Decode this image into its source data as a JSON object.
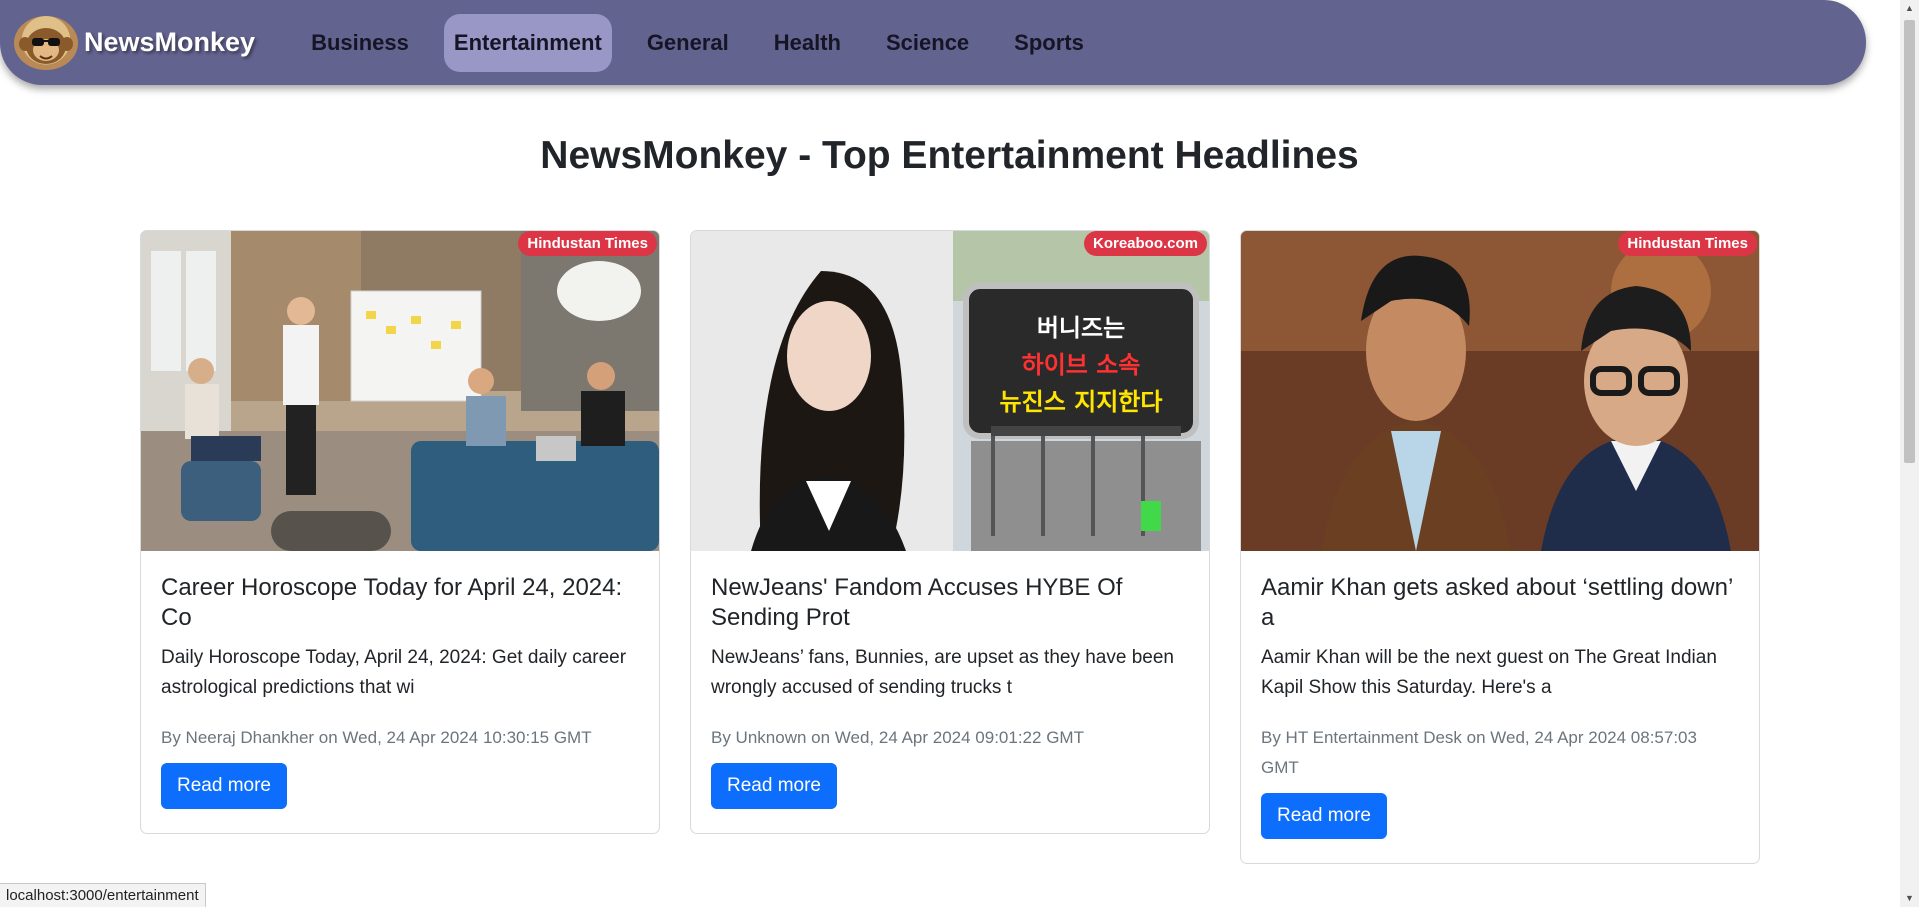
{
  "navbar": {
    "brand": "NewsMonkey",
    "links": [
      {
        "label": "Business",
        "active": false
      },
      {
        "label": "Entertainment",
        "active": true
      },
      {
        "label": "General",
        "active": false
      },
      {
        "label": "Health",
        "active": false
      },
      {
        "label": "Science",
        "active": false
      },
      {
        "label": "Sports",
        "active": false
      }
    ]
  },
  "page": {
    "heading": "NewsMonkey - Top Entertainment Headlines"
  },
  "articles": [
    {
      "source": "Hindustan Times",
      "title": "Career Horoscope Today for April 24, 2024: Co",
      "description": "Daily Horoscope Today, April 24, 2024: Get daily career astrological predictions that wi",
      "meta": "By Neeraj Dhankher on Wed, 24 Apr 2024 10:30:15 GMT",
      "button": "Read more"
    },
    {
      "source": "Koreaboo.com",
      "title": "NewJeans' Fandom Accuses HYBE Of Sending Prot",
      "description": "NewJeans’ fans, Bunnies, are upset as they have been wrongly accused of sending trucks t",
      "meta": "By Unknown on Wed, 24 Apr 2024 09:01:22 GMT",
      "button": "Read more",
      "image_sign_lines": [
        "버니즈는",
        "하이브 소속",
        "뉴진스 지지한다"
      ]
    },
    {
      "source": "Hindustan Times",
      "title": "Aamir Khan gets asked about ‘settling down’ a",
      "description": "Aamir Khan will be the next guest on The Great Indian Kapil Show this Saturday. Here's a",
      "meta": "By HT Entertainment Desk on Wed, 24 Apr 2024 08:57:03 GMT",
      "button": "Read more"
    }
  ],
  "status_bar": {
    "url": "localhost:3000/entertainment"
  },
  "colors": {
    "navbar": "#63638f",
    "active_tab": "#9897c6",
    "badge": "#dc3545",
    "button": "#0d6efd"
  }
}
